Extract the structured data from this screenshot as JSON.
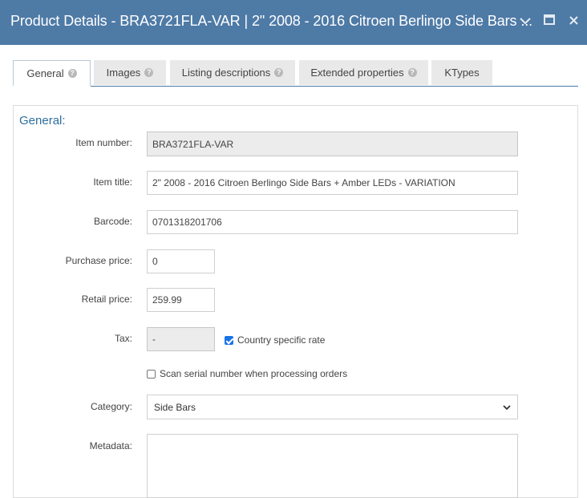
{
  "window": {
    "title": "Product Details - BRA3721FLA-VAR | 2\" 2008 - 2016 Citroen Berlingo Side Bars ..."
  },
  "tabs": [
    {
      "label": "General",
      "active": true,
      "help": true
    },
    {
      "label": "Images",
      "active": false,
      "help": true
    },
    {
      "label": "Listing descriptions",
      "active": false,
      "help": true
    },
    {
      "label": "Extended properties",
      "active": false,
      "help": true
    },
    {
      "label": "KTypes",
      "active": false,
      "help": false
    }
  ],
  "section": {
    "title": "General:"
  },
  "fields": {
    "item_number": {
      "label": "Item number:",
      "value": "BRA3721FLA-VAR"
    },
    "item_title": {
      "label": "Item title:",
      "value": "2\" 2008 - 2016 Citroen Berlingo Side Bars + Amber LEDs - VARIATION"
    },
    "barcode": {
      "label": "Barcode:",
      "value": "0701318201706"
    },
    "purchase_price": {
      "label": "Purchase price:",
      "value": "0"
    },
    "retail_price": {
      "label": "Retail price:",
      "value": "259.99"
    },
    "tax": {
      "label": "Tax:",
      "value": "-"
    },
    "country_rate": {
      "label": "Country specific rate",
      "checked": true
    },
    "scan_serial": {
      "label": "Scan serial number when processing orders",
      "checked": false
    },
    "category": {
      "label": "Category:",
      "value": "Side Bars"
    },
    "metadata": {
      "label": "Metadata:",
      "value": ""
    }
  },
  "colors": {
    "titlebar": "#4e7aa6",
    "section_title": "#2e6f9e",
    "checkbox_on": "#1a73e8"
  },
  "icons": [
    "chevron-down-icon",
    "maximize-icon",
    "close-icon",
    "help-icon",
    "select-arrow-icon"
  ]
}
